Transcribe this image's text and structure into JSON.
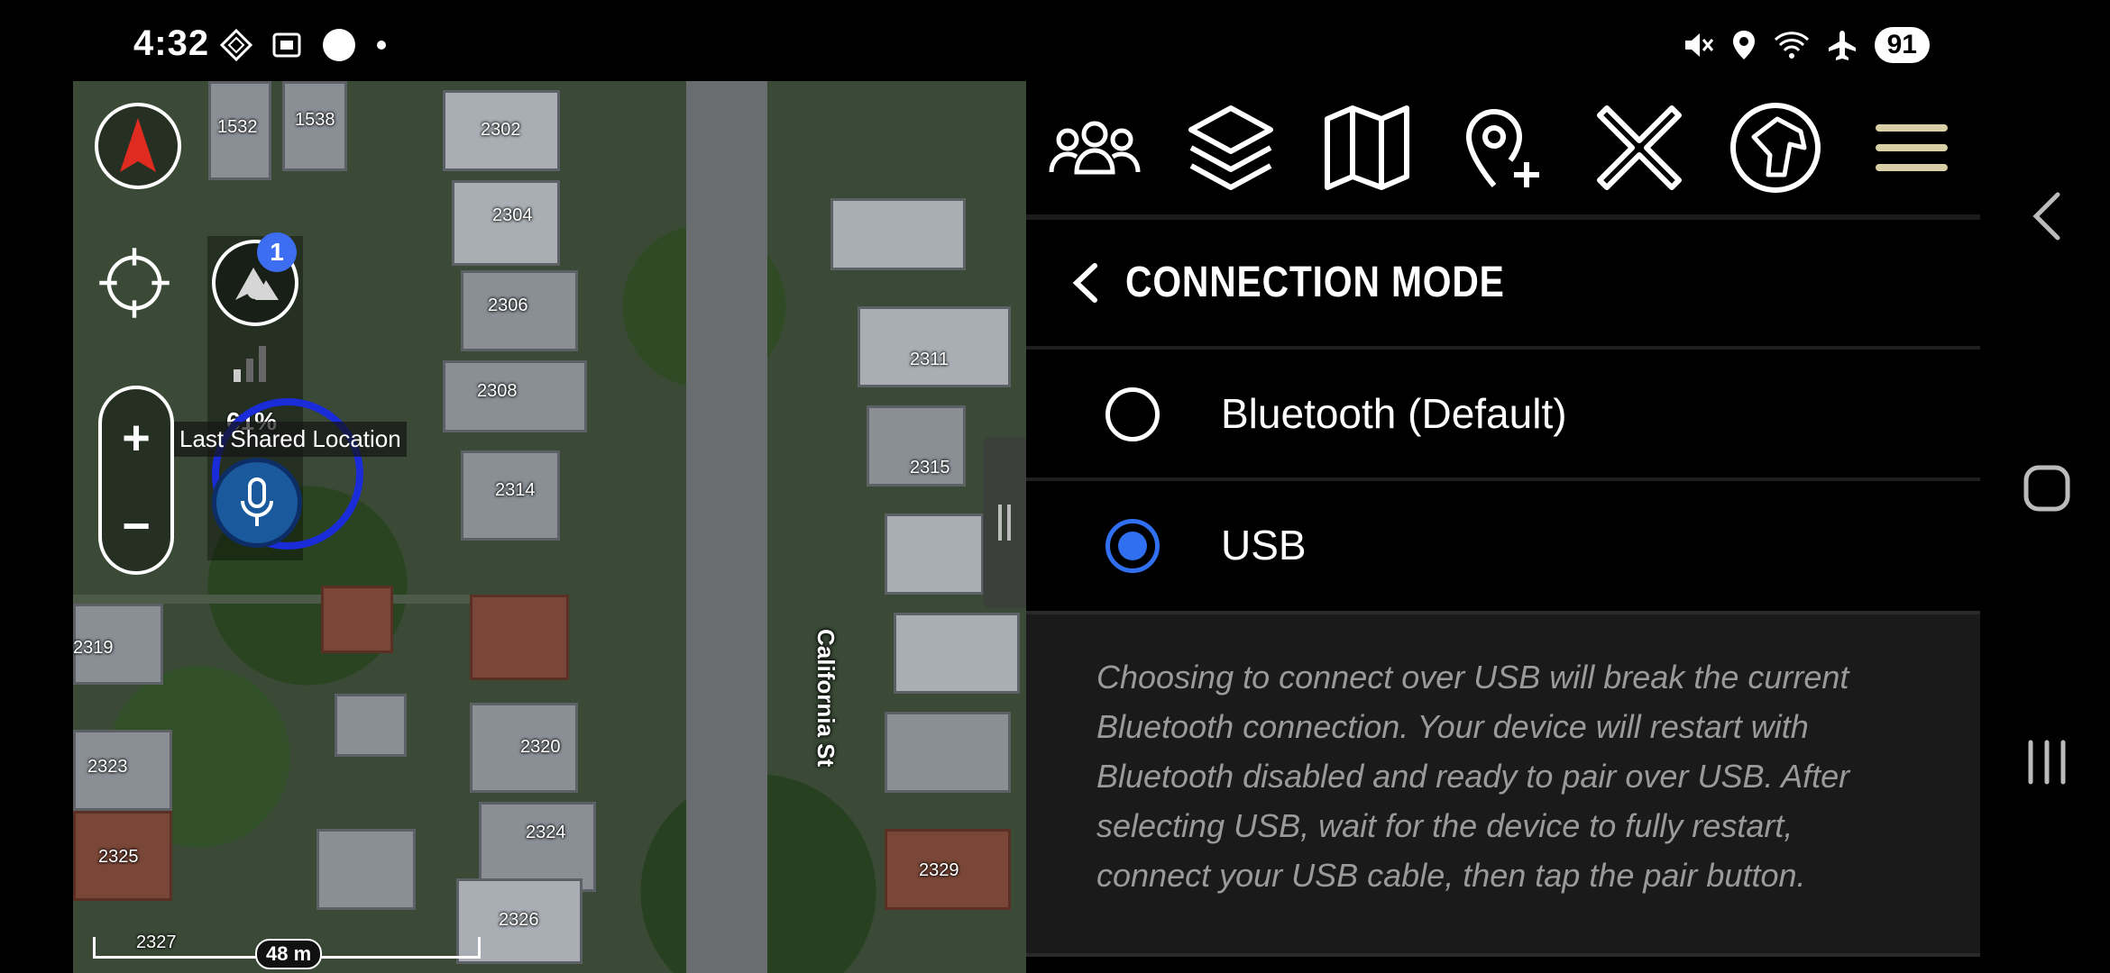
{
  "status_bar": {
    "time": "4:32",
    "battery": "91",
    "left_icons": [
      "diamond-icon",
      "screenshot-icon",
      "circle-icon",
      "dot-icon"
    ],
    "right_icons": [
      "mute-icon",
      "location-icon",
      "wifi-icon",
      "airplane-icon"
    ]
  },
  "map": {
    "addresses": [
      "1532",
      "1538",
      "2302",
      "2304",
      "2306",
      "2308",
      "2314",
      "2311",
      "2315",
      "2319",
      "2320",
      "2323",
      "2324",
      "2325",
      "2326",
      "2327",
      "2329"
    ],
    "street": "California St",
    "share_badge": "1",
    "signal_percent": "61%",
    "last_location_label": "Last Shared Location",
    "scale_label": "48 m",
    "zoom_in": "+",
    "zoom_out": "−"
  },
  "toolbar": {
    "buttons": [
      "contacts-icon",
      "layers-icon",
      "map-icon",
      "add-waypoint-icon",
      "close-icon",
      "dog-icon",
      "menu-icon"
    ],
    "menu_color": "#d9cfa6"
  },
  "panel": {
    "title": "CONNECTION MODE",
    "options": [
      {
        "label": "Bluetooth (Default)",
        "selected": false
      },
      {
        "label": "USB",
        "selected": true
      }
    ],
    "note": "Choosing to connect over USB will break the current Bluetooth connection. Your device will restart with Bluetooth disabled and ready to pair over USB. After selecting USB, wait for the device to fully restart, connect your USB cable, then tap the pair button.",
    "accent": "#2f6ff0"
  },
  "navbar": {
    "buttons": [
      "back-icon",
      "home-icon",
      "recents-icon"
    ]
  }
}
